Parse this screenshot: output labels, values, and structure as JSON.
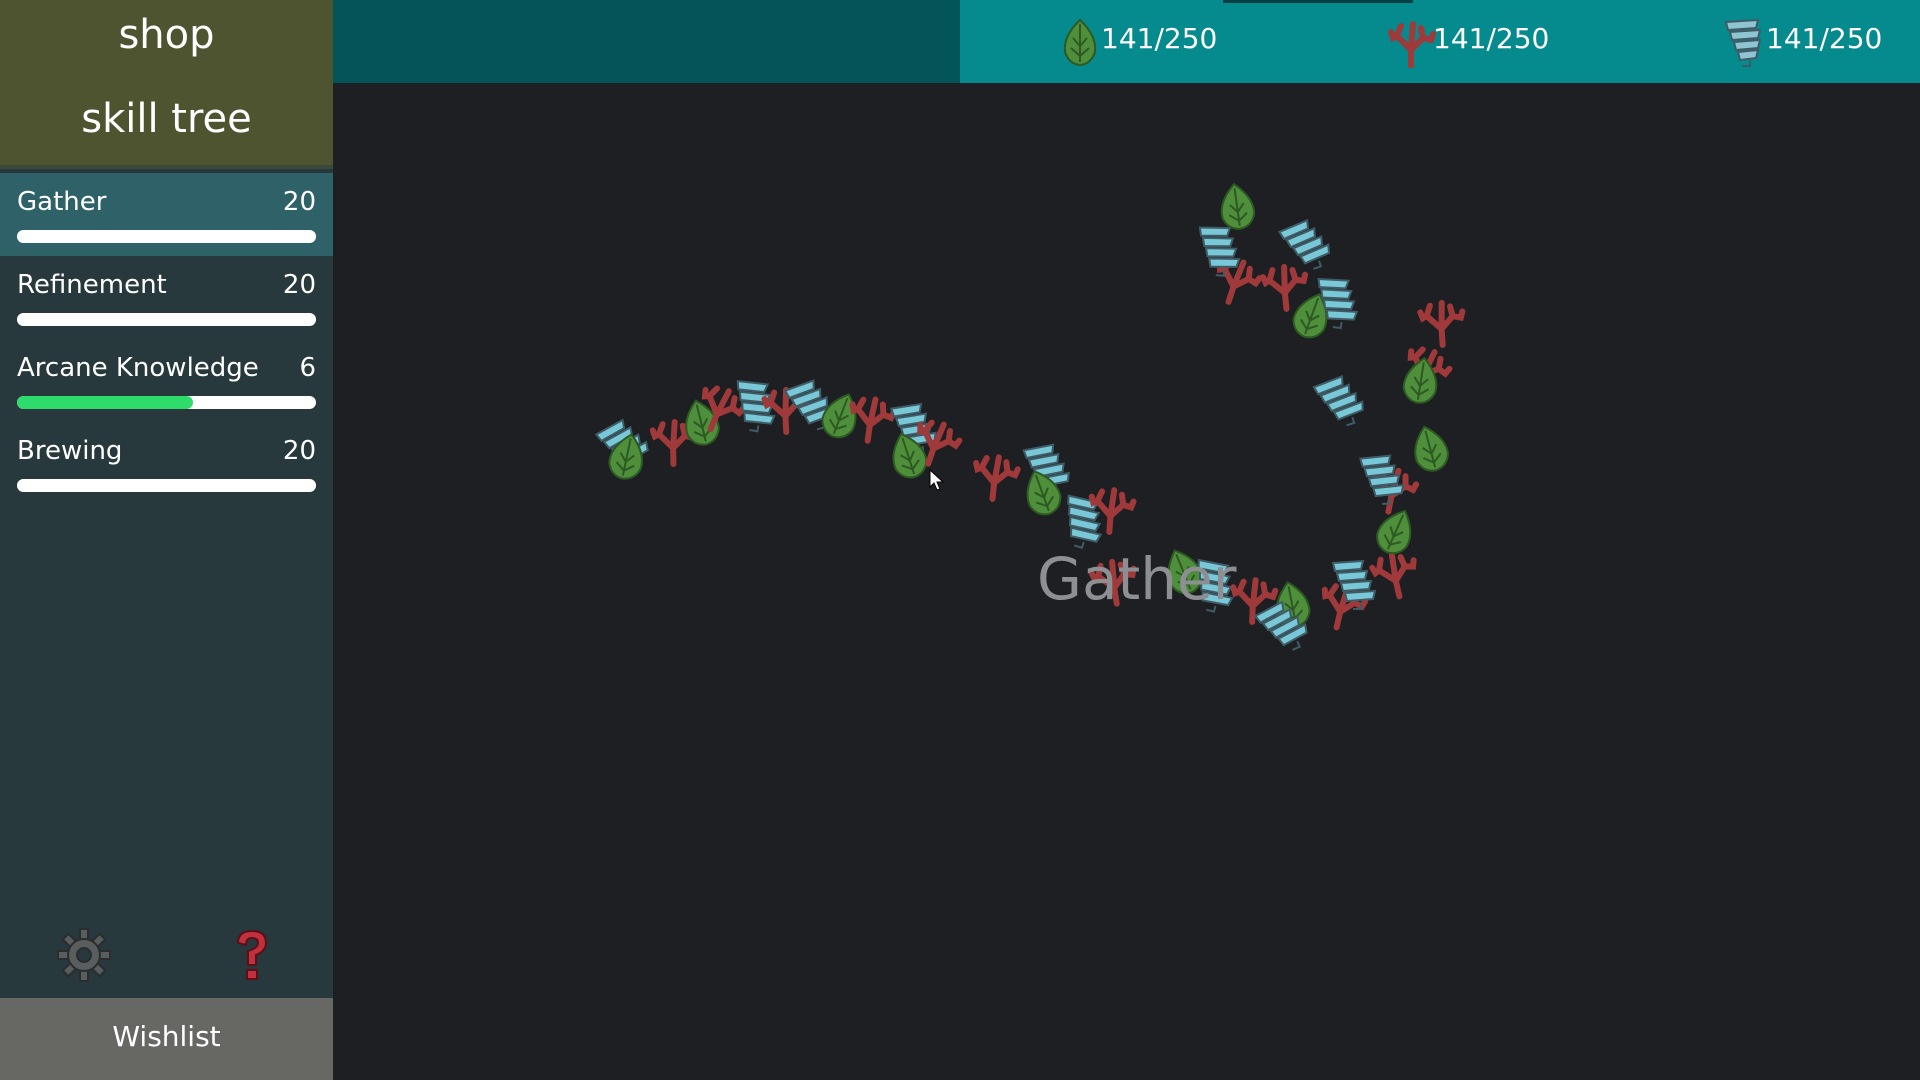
{
  "sidebar": {
    "menu": {
      "shop_label": "shop",
      "skill_tree_label": "skill tree"
    },
    "skills": [
      {
        "name": "Gather",
        "level": "20",
        "progress": 1.0,
        "active": true,
        "bar_color": "#ffffff"
      },
      {
        "name": "Refinement",
        "level": "20",
        "progress": 1.0,
        "active": false,
        "bar_color": "#ffffff"
      },
      {
        "name": "Arcane Knowledge",
        "level": "6",
        "progress": 0.59,
        "active": false,
        "bar_color": "#2ddc6a"
      },
      {
        "name": "Brewing",
        "level": "20",
        "progress": 1.0,
        "active": false,
        "bar_color": "#ffffff"
      }
    ],
    "settings_icon": "gear-icon",
    "help_icon": "question-mark-icon",
    "wishlist_label": "Wishlist"
  },
  "resources": [
    {
      "icon": "leaf-icon",
      "count": "141/250"
    },
    {
      "icon": "coral-icon",
      "count": "141/250"
    },
    {
      "icon": "crystal-icon",
      "count": "141/250"
    }
  ],
  "play_area": {
    "label": "Gather",
    "item_types": [
      "leaf",
      "coral",
      "crystal"
    ]
  },
  "colors": {
    "sidebar_bg": "#27393c",
    "menu_bg": "#4e5430",
    "topbar_bg": "#03555a",
    "resource_bg": "#058a8e",
    "active_skill_bg": "#2f6268",
    "play_bg": "#1e1f23",
    "leaf": "#4f8f3c",
    "coral": "#a0393a",
    "crystal": "#78c8d8"
  }
}
